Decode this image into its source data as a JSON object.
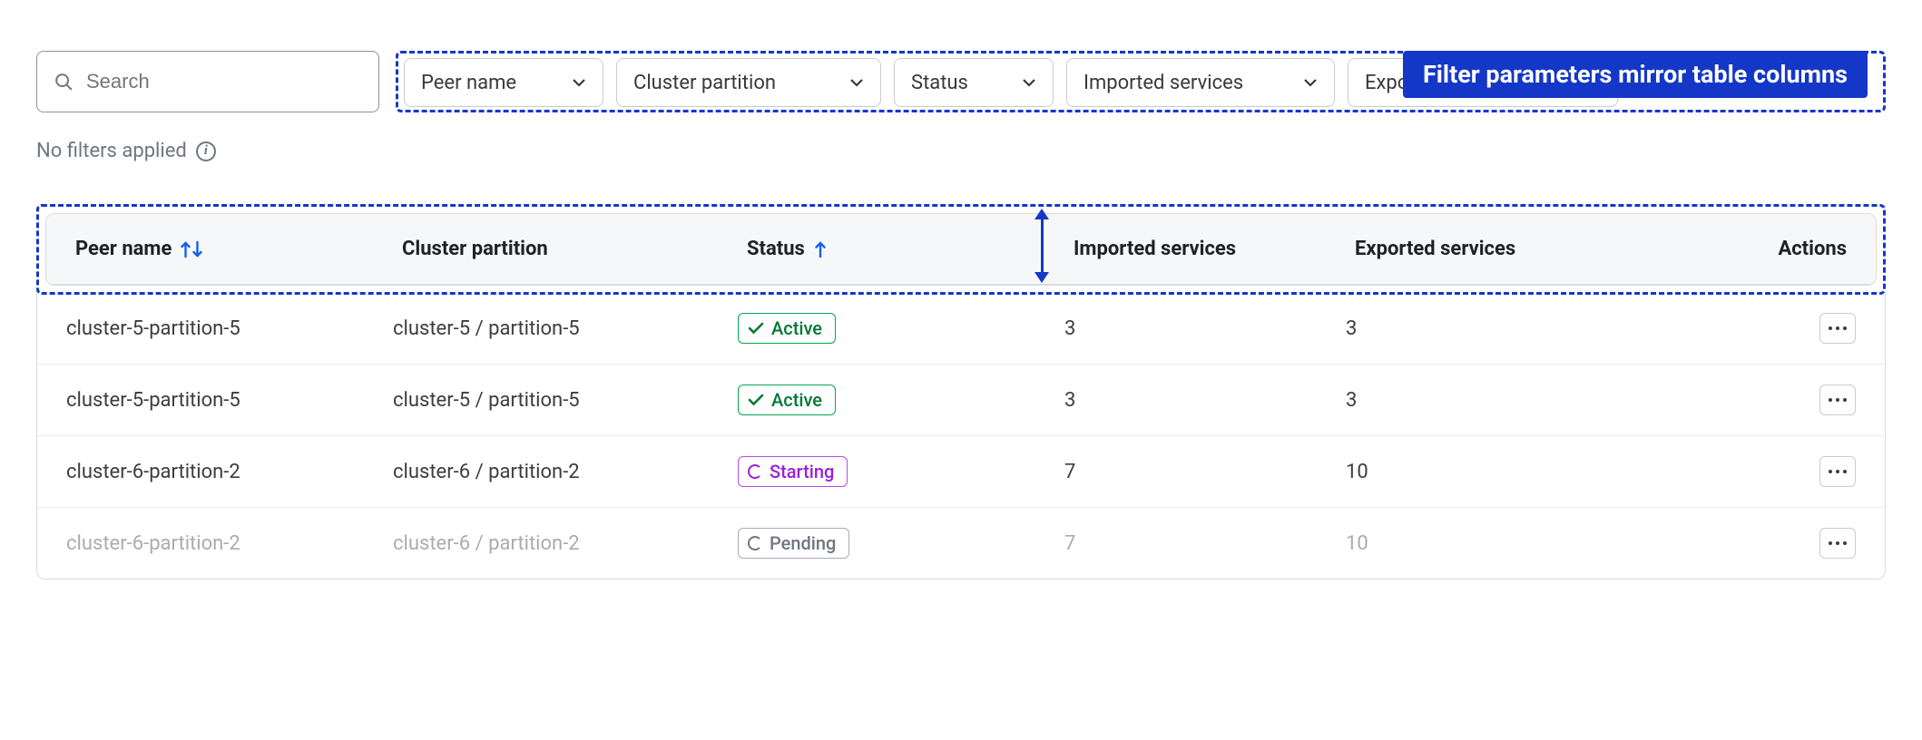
{
  "annotation": {
    "label": "Filter parameters mirror table columns"
  },
  "search": {
    "placeholder": "Search"
  },
  "filters": {
    "peer_name": "Peer name",
    "cluster_partition": "Cluster partition",
    "status": "Status",
    "imported_services": "Imported services",
    "exported_services": "Exported services"
  },
  "status_line": "No filters applied",
  "columns": {
    "peer_name": "Peer name",
    "cluster_partition": "Cluster partition",
    "status": "Status",
    "imported_services": "Imported services",
    "exported_services": "Exported services",
    "actions": "Actions"
  },
  "status_labels": {
    "active": "Active",
    "starting": "Starting",
    "pending": "Pending"
  },
  "rows": [
    {
      "peer": "cluster-5-partition-5",
      "partition": "cluster-5 / partition-5",
      "status": "active",
      "imported": "3",
      "exported": "3"
    },
    {
      "peer": "cluster-5-partition-5",
      "partition": "cluster-5 / partition-5",
      "status": "active",
      "imported": "3",
      "exported": "3"
    },
    {
      "peer": "cluster-6-partition-2",
      "partition": "cluster-6 / partition-2",
      "status": "starting",
      "imported": "7",
      "exported": "10"
    },
    {
      "peer": "cluster-6-partition-2",
      "partition": "cluster-6 / partition-2",
      "status": "pending",
      "imported": "7",
      "exported": "10",
      "muted": true
    }
  ],
  "colors": {
    "accent": "#1537c8",
    "active": "#00a850",
    "starting": "#b84ce6",
    "pending": "#a9acb3"
  }
}
